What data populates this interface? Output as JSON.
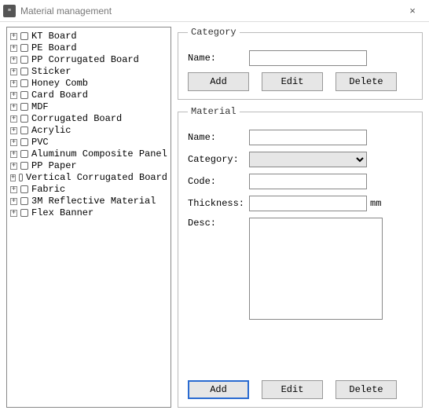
{
  "window": {
    "title": "Material management",
    "close_glyph": "×"
  },
  "tree": {
    "items": [
      {
        "label": "KT Board"
      },
      {
        "label": "PE Board"
      },
      {
        "label": "PP Corrugated Board"
      },
      {
        "label": "Sticker"
      },
      {
        "label": "Honey Comb"
      },
      {
        "label": "Card Board"
      },
      {
        "label": "MDF"
      },
      {
        "label": "Corrugated Board"
      },
      {
        "label": "Acrylic"
      },
      {
        "label": "PVC"
      },
      {
        "label": "Aluminum Composite Panel"
      },
      {
        "label": "PP Paper"
      },
      {
        "label": "Vertical Corrugated Board"
      },
      {
        "label": "Fabric"
      },
      {
        "label": "3M Reflective Material"
      },
      {
        "label": "Flex Banner"
      }
    ]
  },
  "category": {
    "legend": "Category",
    "name_label": "Name:",
    "name_value": "",
    "add_label": "Add",
    "edit_label": "Edit",
    "delete_label": "Delete"
  },
  "material": {
    "legend": "Material",
    "name_label": "Name:",
    "name_value": "",
    "category_label": "Category:",
    "category_value": "",
    "code_label": "Code:",
    "code_value": "",
    "thickness_label": "Thickness:",
    "thickness_value": "",
    "thickness_unit": "mm",
    "desc_label": "Desc:",
    "desc_value": "",
    "add_label": "Add",
    "edit_label": "Edit",
    "delete_label": "Delete"
  }
}
